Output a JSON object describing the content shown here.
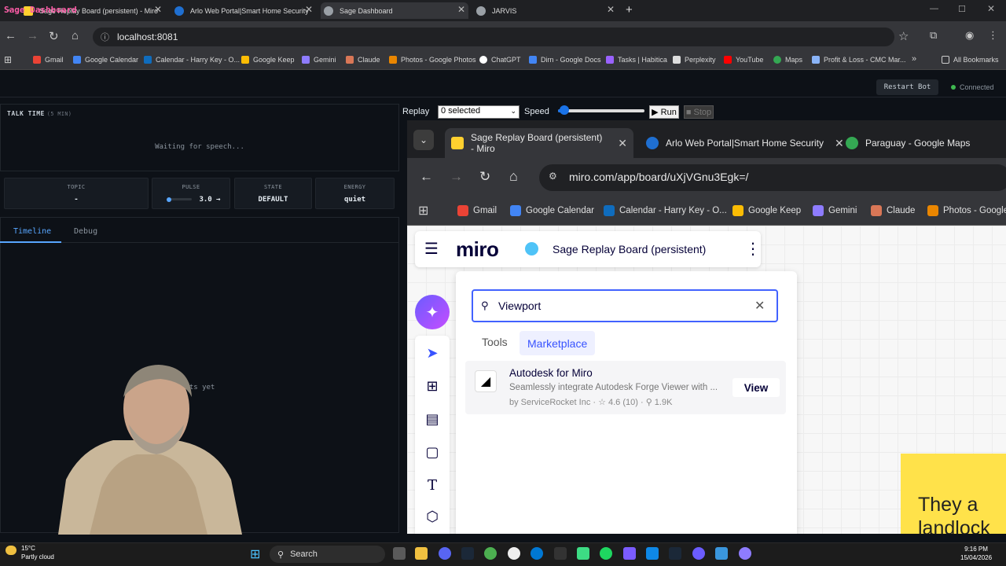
{
  "browser": {
    "tabs": [
      {
        "title": "Sage Replay Board (persistent) - Miro",
        "color": "#ffd02f"
      },
      {
        "title": "Arlo Web Portal|Smart Home Security",
        "color": "#1f6fd1"
      },
      {
        "title": "Sage Dashboard",
        "color": "#9aa0a6"
      },
      {
        "title": "JARVIS",
        "color": "#9aa0a6"
      }
    ],
    "url": "localhost:8081",
    "bookmarks": [
      {
        "label": "Gmail",
        "color": "#ea4335"
      },
      {
        "label": "Google Calendar",
        "color": "#4285f4"
      },
      {
        "label": "Calendar - Harry Key - O...",
        "color": "#0f6cbd"
      },
      {
        "label": "Google Keep",
        "color": "#fbbc04"
      },
      {
        "label": "Gemini",
        "color": "#8e7cff"
      },
      {
        "label": "Claude",
        "color": "#d97757"
      },
      {
        "label": "Photos - Google Photos",
        "color": "#ea8600"
      },
      {
        "label": "ChatGPT",
        "color": "#ffffff"
      },
      {
        "label": "Dirn - Google Docs",
        "color": "#4285f4"
      },
      {
        "label": "Tasks | Habitica",
        "color": "#9a62ff"
      },
      {
        "label": "Perplexity",
        "color": "#dddddd"
      },
      {
        "label": "YouTube",
        "color": "#ff0000"
      },
      {
        "label": "Maps",
        "color": "#34a853"
      },
      {
        "label": "Profit & Loss - CMC Mar...",
        "color": "#8ab4f8"
      }
    ],
    "all_bookmarks": "All Bookmarks"
  },
  "dashboard": {
    "title": "Sage Dashboard",
    "restart_label": "Restart Bot",
    "status": "Connected",
    "talk_time_label": "TALK TIME",
    "talk_time_sub": "(5 MIN)",
    "waiting": "Waiting for speech...",
    "stats": [
      {
        "label": "TOPIC",
        "value": "-"
      },
      {
        "label": "PULSE",
        "value": "3.0 →"
      },
      {
        "label": "STATE",
        "value": "DEFAULT"
      },
      {
        "label": "ENERGY",
        "value": "quiet"
      }
    ],
    "tabs": [
      "Timeline",
      "Debug"
    ],
    "empty_text": "ents yet"
  },
  "replay": {
    "label": "Replay",
    "selected": "0 selected",
    "speed_label": "Speed",
    "run_label": "▶ Run",
    "stop_label": "■ Stop"
  },
  "inner_browser": {
    "tabs": [
      {
        "title": "Sage Replay Board (persistent) - Miro",
        "color": "#ffd02f"
      },
      {
        "title": "Arlo Web Portal|Smart Home Security",
        "color": "#1f6fd1"
      },
      {
        "title": "Paraguay - Google Maps",
        "color": "#34a853"
      }
    ],
    "url": "miro.com/app/board/uXjVGnu3Egk=/",
    "bookmarks": [
      {
        "label": "Gmail",
        "color": "#ea4335"
      },
      {
        "label": "Google Calendar",
        "color": "#4285f4"
      },
      {
        "label": "Calendar - Harry Key - O...",
        "color": "#0f6cbd"
      },
      {
        "label": "Google Keep",
        "color": "#fbbc04"
      },
      {
        "label": "Gemini",
        "color": "#8e7cff"
      },
      {
        "label": "Claude",
        "color": "#d97757"
      },
      {
        "label": "Photos - Google",
        "color": "#ea8600"
      }
    ]
  },
  "miro": {
    "logo": "miro",
    "board_name": "Sage Replay Board (persistent)",
    "search_value": "Viewport",
    "tab_tools": "Tools",
    "tab_marketplace": "Marketplace",
    "result": {
      "title": "Autodesk for Miro",
      "description": "Seamlessly integrate Autodesk Forge Viewer with ...",
      "meta": "by ServiceRocket Inc  ·  ☆ 4.6 (10)  ·  ⚲ 1.9K",
      "view_label": "View"
    },
    "sticky_text": "They a\nlandlock"
  },
  "taskbar": {
    "weather_temp": "15°C",
    "weather_desc": "Partly cloud",
    "search": "Search",
    "time": "9:16 PM",
    "date": "15/04/2026"
  }
}
